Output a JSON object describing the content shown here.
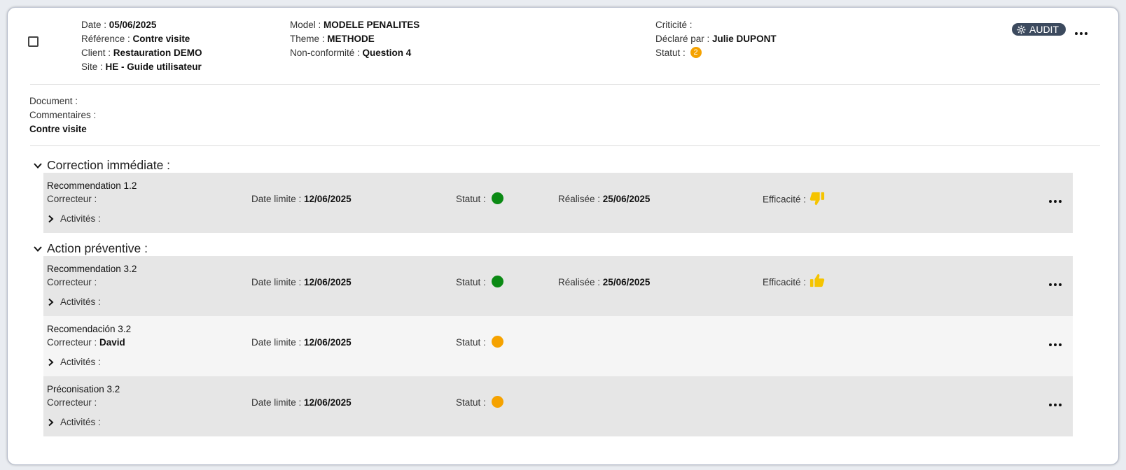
{
  "header": {
    "date_label": "Date : ",
    "date_value": "05/06/2025",
    "reference_label": "Référence : ",
    "reference_value": "Contre visite",
    "client_label": "Client : ",
    "client_value": "Restauration DEMO",
    "site_label": "Site : ",
    "site_value": "HE - Guide utilisateur",
    "model_label": "Model : ",
    "model_value": "MODELE PENALITES",
    "theme_label": "Theme : ",
    "theme_value": "METHODE",
    "nc_label": "Non-conformité : ",
    "nc_value": "Question 4",
    "criticite_label": "Criticité :",
    "declare_label": "Déclaré par : ",
    "declare_value": "Julie DUPONT",
    "statut_label": "Statut : ",
    "statut_badge": "2",
    "audit_label": "AUDIT"
  },
  "info": {
    "document_label": "Document :",
    "commentaires_label": "Commentaires :",
    "commentaires_value": "Contre visite"
  },
  "sections": {
    "correction": "Correction immédiate :",
    "preventive": "Action préventive :"
  },
  "rows": [
    {
      "title": "Recommendation 1.2",
      "correcteur_label": "Correcteur :",
      "correcteur_value": "",
      "date_label": "Date limite : ",
      "date_value": "12/06/2025",
      "statut_label": "Statut :",
      "status_color": "#0b8a14",
      "realisee_label": "Réalisée : ",
      "realisee_value": "25/06/2025",
      "efficacite_label": "Efficacité :",
      "efficacite_icon": "thumbs-down-icon",
      "activites_label": "Activités :"
    },
    {
      "title": "Recommendation 3.2",
      "correcteur_label": "Correcteur :",
      "correcteur_value": "",
      "date_label": "Date limite : ",
      "date_value": "12/06/2025",
      "statut_label": "Statut :",
      "status_color": "#0b8a14",
      "realisee_label": "Réalisée : ",
      "realisee_value": "25/06/2025",
      "efficacite_label": "Efficacité :",
      "efficacite_icon": "thumbs-up-icon",
      "activites_label": "Activités :"
    },
    {
      "title": "Recomendación 3.2",
      "correcteur_label": "Correcteur : ",
      "correcteur_value": "David",
      "date_label": "Date limite : ",
      "date_value": "12/06/2025",
      "statut_label": "Statut :",
      "status_color": "#f5a200",
      "activites_label": "Activités :"
    },
    {
      "title": "Préconisation 3.2",
      "correcteur_label": "Correcteur :",
      "correcteur_value": "",
      "date_label": "Date limite : ",
      "date_value": "12/06/2025",
      "statut_label": "Statut :",
      "status_color": "#f5a200",
      "activites_label": "Activités :"
    }
  ],
  "colors": {
    "efficacite_icon": "#f5c400",
    "audit_bg": "#3c4a5e"
  }
}
